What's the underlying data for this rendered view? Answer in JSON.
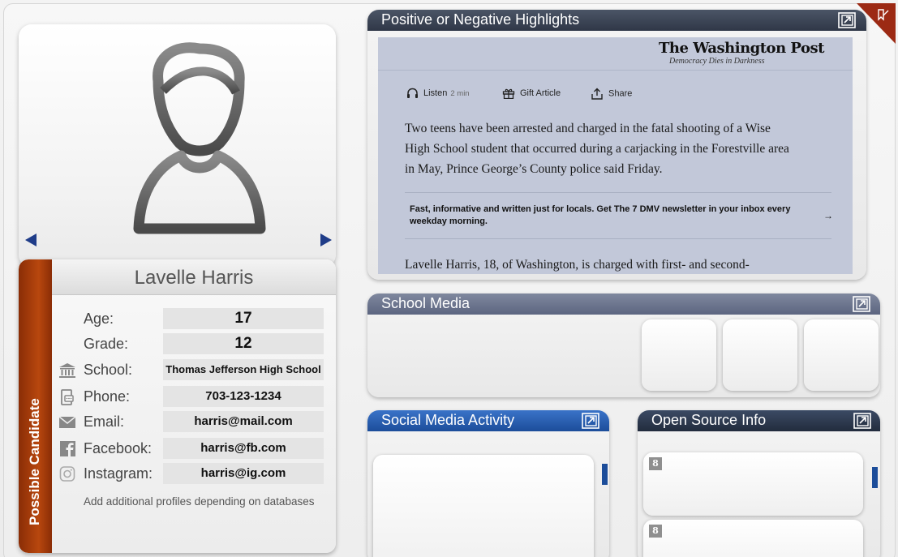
{
  "colors": {
    "accent_rust": "#a63d0c",
    "nav_blue": "#1f3c88",
    "header_dark": "#2f3747",
    "header_blue": "#1c4d9a",
    "corner_red": "#9c2a14"
  },
  "profile": {
    "name": "Lavelle Harris",
    "side_tab": "Possible Candidate",
    "fields": [
      {
        "label": "Age:",
        "value": "17",
        "icon": ""
      },
      {
        "label": "Grade:",
        "value": "12",
        "icon": ""
      },
      {
        "label": "School:",
        "value": "Thomas Jefferson High School",
        "icon": "school-building-icon"
      },
      {
        "label": "Phone:",
        "value": "703-123-1234",
        "icon": "phone-icon"
      },
      {
        "label": "Email:",
        "value": "harris@mail.com",
        "icon": "envelope-icon"
      },
      {
        "label": "Facebook:",
        "value": "harris@fb.com",
        "icon": "facebook-icon"
      },
      {
        "label": "Instagram:",
        "value": "harris@ig.com",
        "icon": "instagram-icon"
      }
    ],
    "note": "Add additional profiles depending on databases"
  },
  "highlights": {
    "title": "Positive or Negative Highlights",
    "article": {
      "masthead": "The Washington Post",
      "tagline": "Democracy Dies in Darkness",
      "listen_label": "Listen",
      "listen_duration": "2 min",
      "gift_label": "Gift Article",
      "share_label": "Share",
      "body": "Two teens have been arrested and charged in the fatal shooting of a Wise High School student that occurred during a carjacking in the Forestville area in May, Prince George’s County police said Friday.",
      "newsletter": "Fast, informative and written just for locals. Get The 7 DMV newsletter in your inbox every weekday morning.",
      "next_line": "Lavelle Harris, 18, of Washington, is charged with first- and second-"
    }
  },
  "school_media": {
    "title": "School Media"
  },
  "social_media": {
    "title": "Social Media Activity"
  },
  "open_source": {
    "title": "Open Source Info",
    "badge": "8"
  }
}
